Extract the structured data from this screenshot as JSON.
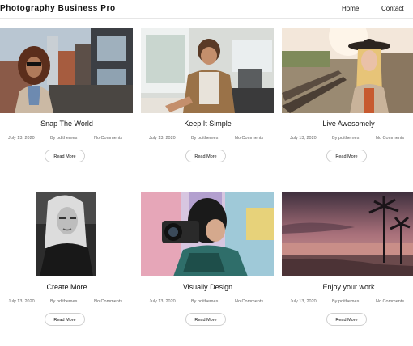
{
  "header": {
    "brand": "Photography Business Pro",
    "nav": [
      {
        "label": "Home"
      },
      {
        "label": "Contact"
      }
    ]
  },
  "posts": [
    {
      "title": "Snap The World",
      "date": "July 13, 2020",
      "author": "By pdithemes",
      "comments": "No Comments",
      "button": "Read More",
      "image": "woman-sunglasses-photo"
    },
    {
      "title": "Keep It Simple",
      "date": "July 13, 2020",
      "author": "By pdithemes",
      "comments": "No Comments",
      "button": "Read More",
      "image": "man-writing-photo"
    },
    {
      "title": "Live Awesomely",
      "date": "July 13, 2020",
      "author": "By pdithemes",
      "comments": "No Comments",
      "button": "Read More",
      "image": "woman-hat-railway-photo"
    },
    {
      "title": "Create More",
      "date": "July 13, 2020",
      "author": "By pdithemes",
      "comments": "No Comments",
      "button": "Read More",
      "image": "bw-portrait-photo"
    },
    {
      "title": "Visually Design",
      "date": "July 13, 2020",
      "author": "By pdithemes",
      "comments": "No Comments",
      "button": "Read More",
      "image": "photographer-camera-photo"
    },
    {
      "title": "Enjoy your work",
      "date": "July 13, 2020",
      "author": "By pdithemes",
      "comments": "No Comments",
      "button": "Read More",
      "image": "beach-sunset-photo"
    }
  ]
}
